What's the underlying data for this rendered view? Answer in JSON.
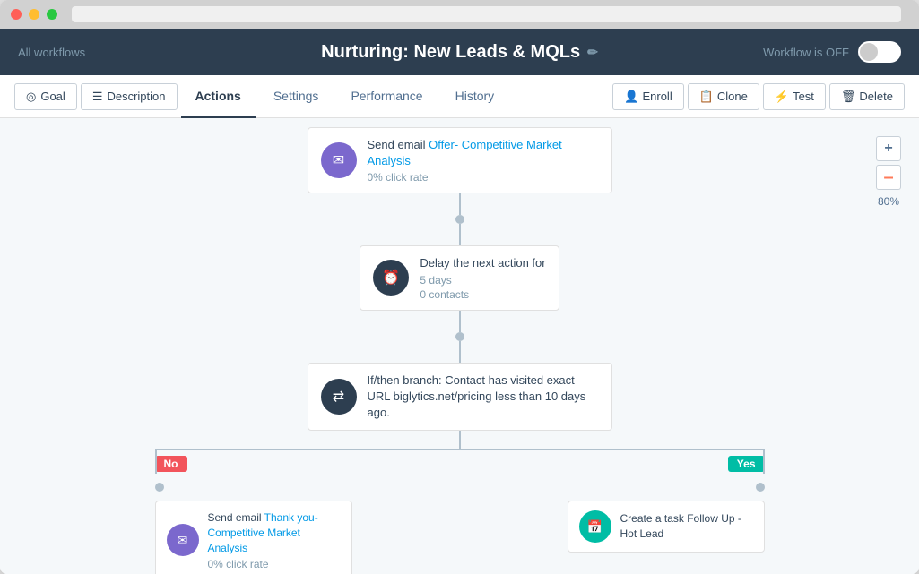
{
  "window": {
    "title": "Nurturing: New Leads & MQLs"
  },
  "header": {
    "back_link": "All workflows",
    "title": "Nurturing: New Leads & MQLs",
    "workflow_status": "Workflow is OFF",
    "edit_icon": "✏"
  },
  "nav": {
    "tabs": [
      {
        "id": "goal",
        "label": "Goal",
        "icon": "◎",
        "active": false
      },
      {
        "id": "description",
        "label": "Description",
        "icon": "☰",
        "active": false
      },
      {
        "id": "actions",
        "label": "Actions",
        "active": true
      },
      {
        "id": "settings",
        "label": "Settings",
        "active": false
      },
      {
        "id": "performance",
        "label": "Performance",
        "active": false
      },
      {
        "id": "history",
        "label": "History",
        "active": false
      }
    ],
    "action_buttons": [
      {
        "id": "enroll",
        "label": "Enroll",
        "icon": "👤"
      },
      {
        "id": "clone",
        "label": "Clone",
        "icon": "📋"
      },
      {
        "id": "test",
        "label": "Test",
        "icon": "⚡"
      },
      {
        "id": "delete",
        "label": "Delete",
        "icon": "🗑"
      }
    ]
  },
  "zoom": {
    "plus_label": "+",
    "minus_label": "–",
    "level": "80%"
  },
  "flow": {
    "nodes": [
      {
        "id": "node1",
        "type": "email",
        "icon_symbol": "✉",
        "icon_class": "icon-email",
        "title_prefix": "Send email ",
        "title_link": "Offer- Competitive Market Analysis",
        "subtitle": "0% click rate"
      },
      {
        "id": "node2",
        "type": "delay",
        "icon_symbol": "⏰",
        "icon_class": "icon-delay",
        "title": "Delay the next action for",
        "lines": [
          "5 days",
          "0 contacts"
        ]
      },
      {
        "id": "node3",
        "type": "branch",
        "icon_symbol": "⇄",
        "icon_class": "icon-branch",
        "title": "If/then branch: Contact has visited exact URL biglytics.net/pricing less than 10 days ago."
      }
    ],
    "branch_labels": {
      "no": "No",
      "yes": "Yes"
    },
    "bottom_nodes": [
      {
        "id": "node4",
        "type": "email",
        "icon_symbol": "✉",
        "icon_class": "icon-email",
        "title_prefix": "Send email ",
        "title_link": "Thank you- Competitive Market Analysis",
        "subtitle": "0% click rate"
      },
      {
        "id": "node5",
        "type": "task",
        "icon_symbol": "📅",
        "icon_class": "icon-task",
        "title": "Create a task Follow Up - Hot Lead",
        "subtitle": ""
      }
    ]
  }
}
